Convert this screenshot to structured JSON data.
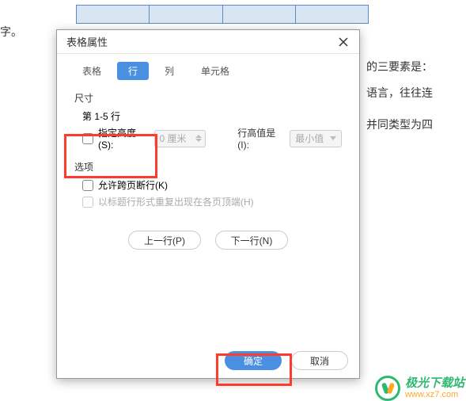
{
  "background": {
    "text1": "字。",
    "text2": "的三要素是：",
    "text3": "语言，往往连",
    "text4": "并同类型为四"
  },
  "dialog": {
    "title": "表格属性",
    "tabs": [
      "表格",
      "行",
      "列",
      "单元格"
    ],
    "activeTab": 1,
    "size": {
      "title": "尺寸",
      "rowRange": "第  1-5  行",
      "heightCheckLabel": "指定高度(S):",
      "heightValue": "0 厘米",
      "rowHighLabel": "行高值是(I):",
      "rowHighValue": "最小值"
    },
    "options": {
      "title": "选项",
      "breakAcross": "允许跨页断行(K)",
      "repeatHeader": "以标题行形式重复出现在各页顶端(H)"
    },
    "nav": {
      "prev": "上一行(P)",
      "next": "下一行(N)"
    },
    "footer": {
      "ok": "确定",
      "cancel": "取消"
    }
  },
  "watermark": {
    "line1": "极光下载站",
    "line2": "www.xz7.com"
  }
}
